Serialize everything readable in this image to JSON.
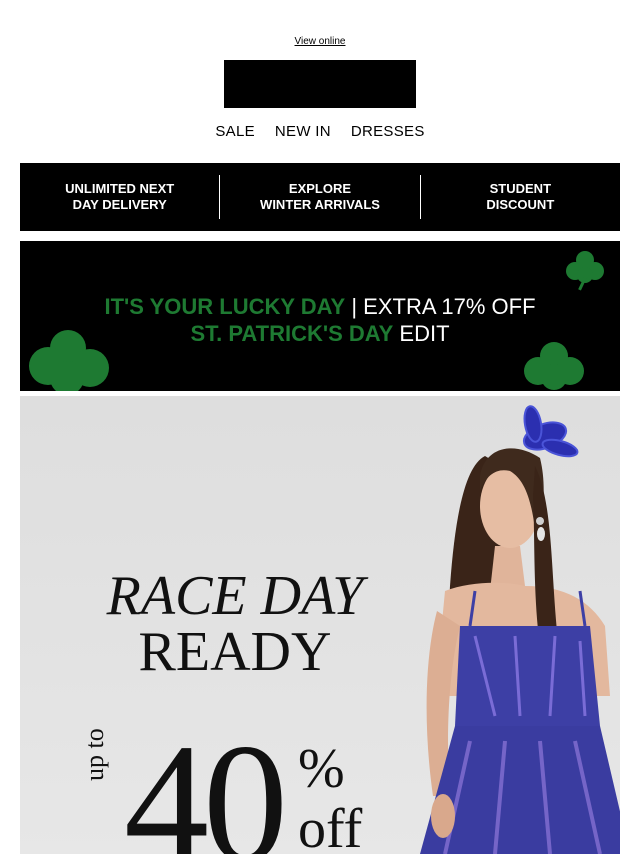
{
  "header": {
    "view_online": "View online"
  },
  "nav": {
    "items": [
      "SALE",
      "NEW IN",
      "DRESSES"
    ]
  },
  "usp_bar": {
    "items": [
      "UNLIMITED NEXT\nDAY DELIVERY",
      "EXPLORE\nWINTER ARRIVALS",
      "STUDENT\nDISCOUNT"
    ]
  },
  "promo": {
    "line1_green": "IT'S YOUR LUCKY DAY",
    "line1_white": " | EXTRA 17% OFF",
    "line2_green": "ST. PATRICK'S DAY",
    "line2_white": " EDIT",
    "clover_color": "#1e7a32"
  },
  "hero": {
    "title_line1": "RACE DAY",
    "title_line2": "READY",
    "up_to": "up to",
    "percent_value": "40",
    "percent_sign": "%",
    "off": "off",
    "dress_color": "#3b3fa8"
  }
}
